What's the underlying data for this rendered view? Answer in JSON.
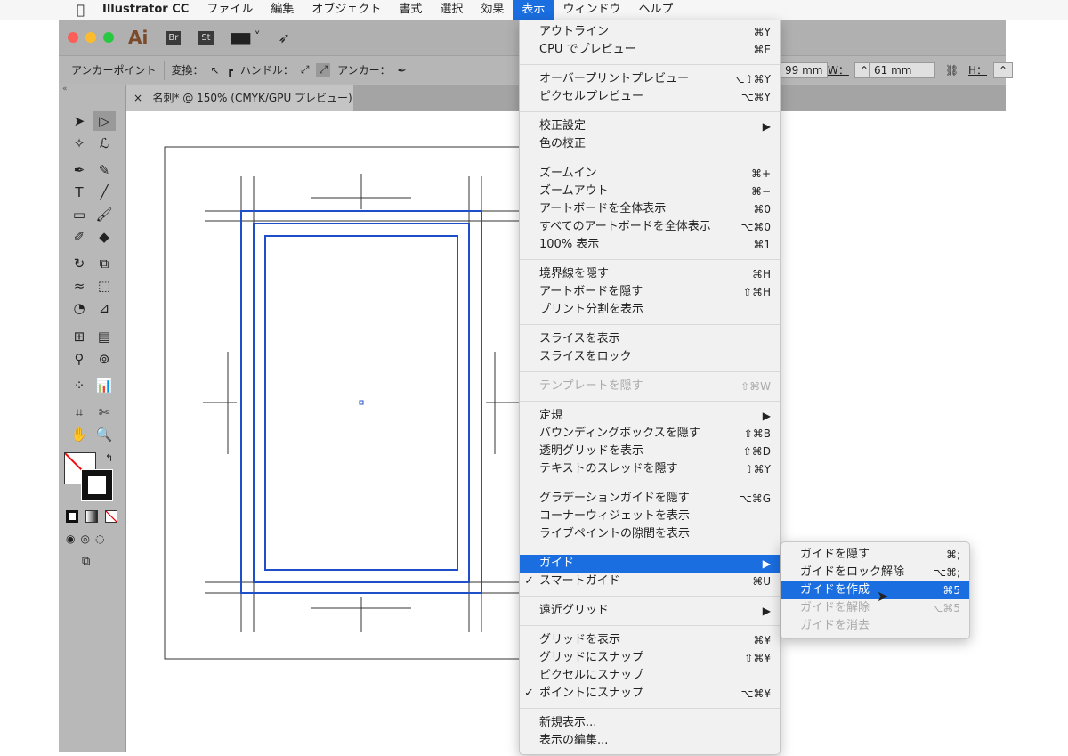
{
  "menubar": {
    "apple": "",
    "app": "Illustrator CC",
    "items": [
      "ファイル",
      "編集",
      "オブジェクト",
      "書式",
      "選択",
      "効果",
      "表示",
      "ウィンドウ",
      "ヘルプ"
    ]
  },
  "titlebar": {
    "logo": "Ai",
    "br": "Br",
    "st": "St"
  },
  "control": {
    "label": "アンカーポイント",
    "convert": "変換：",
    "handle": "ハンドル：",
    "anchor": "アンカー：",
    "x_value": "99 mm",
    "w_label": "W：",
    "w_value": "61 mm",
    "h_label": "H："
  },
  "document_tab": {
    "close": "×",
    "title": "名刺* @ 150% (CMYK/GPU プレビュー)"
  },
  "view_menu": {
    "groups": [
      [
        {
          "label": "アウトライン",
          "shortcut": "⌘Y"
        },
        {
          "label": "CPU でプレビュー",
          "shortcut": "⌘E"
        }
      ],
      [
        {
          "label": "オーバープリントプレビュー",
          "shortcut": "⌥⇧⌘Y"
        },
        {
          "label": "ピクセルプレビュー",
          "shortcut": "⌥⌘Y"
        }
      ],
      [
        {
          "label": "校正設定",
          "shortcut": "▶"
        },
        {
          "label": "色の校正",
          "shortcut": ""
        }
      ],
      [
        {
          "label": "ズームイン",
          "shortcut": "⌘+"
        },
        {
          "label": "ズームアウト",
          "shortcut": "⌘−"
        },
        {
          "label": "アートボードを全体表示",
          "shortcut": "⌘0"
        },
        {
          "label": "すべてのアートボードを全体表示",
          "shortcut": "⌥⌘0"
        },
        {
          "label": "100% 表示",
          "shortcut": "⌘1"
        }
      ],
      [
        {
          "label": "境界線を隠す",
          "shortcut": "⌘H"
        },
        {
          "label": "アートボードを隠す",
          "shortcut": "⇧⌘H"
        },
        {
          "label": "プリント分割を表示",
          "shortcut": ""
        }
      ],
      [
        {
          "label": "スライスを表示",
          "shortcut": ""
        },
        {
          "label": "スライスをロック",
          "shortcut": ""
        }
      ],
      [
        {
          "label": "テンプレートを隠す",
          "shortcut": "⇧⌘W",
          "disabled": true
        }
      ],
      [
        {
          "label": "定規",
          "shortcut": "▶"
        },
        {
          "label": "バウンディングボックスを隠す",
          "shortcut": "⇧⌘B"
        },
        {
          "label": "透明グリッドを表示",
          "shortcut": "⇧⌘D"
        },
        {
          "label": "テキストのスレッドを隠す",
          "shortcut": "⇧⌘Y"
        }
      ],
      [
        {
          "label": "グラデーションガイドを隠す",
          "shortcut": "⌥⌘G"
        },
        {
          "label": "コーナーウィジェットを表示",
          "shortcut": ""
        },
        {
          "label": "ライブペイントの隙間を表示",
          "shortcut": ""
        }
      ],
      [
        {
          "label": "ガイド",
          "shortcut": "▶",
          "highlighted": true
        },
        {
          "label": "スマートガイド",
          "shortcut": "⌘U",
          "checked": true
        }
      ],
      [
        {
          "label": "遠近グリッド",
          "shortcut": "▶"
        }
      ],
      [
        {
          "label": "グリッドを表示",
          "shortcut": "⌘¥"
        },
        {
          "label": "グリッドにスナップ",
          "shortcut": "⇧⌘¥"
        },
        {
          "label": "ピクセルにスナップ",
          "shortcut": ""
        },
        {
          "label": "ポイントにスナップ",
          "shortcut": "⌥⌘¥",
          "checked": true
        }
      ],
      [
        {
          "label": "新規表示...",
          "shortcut": ""
        },
        {
          "label": "表示の編集...",
          "shortcut": ""
        }
      ]
    ]
  },
  "guide_submenu": [
    {
      "label": "ガイドを隠す",
      "shortcut": "⌘;"
    },
    {
      "label": "ガイドをロック解除",
      "shortcut": "⌥⌘;"
    },
    {
      "label": "ガイドを作成",
      "shortcut": "⌘5",
      "highlighted": true
    },
    {
      "label": "ガイドを解除",
      "shortcut": "⌥⌘5",
      "disabled": true
    },
    {
      "label": "ガイドを消去",
      "shortcut": "",
      "disabled": true
    }
  ],
  "colors": {
    "accent": "#1a6ee0",
    "selection": "#1f4fc8"
  }
}
